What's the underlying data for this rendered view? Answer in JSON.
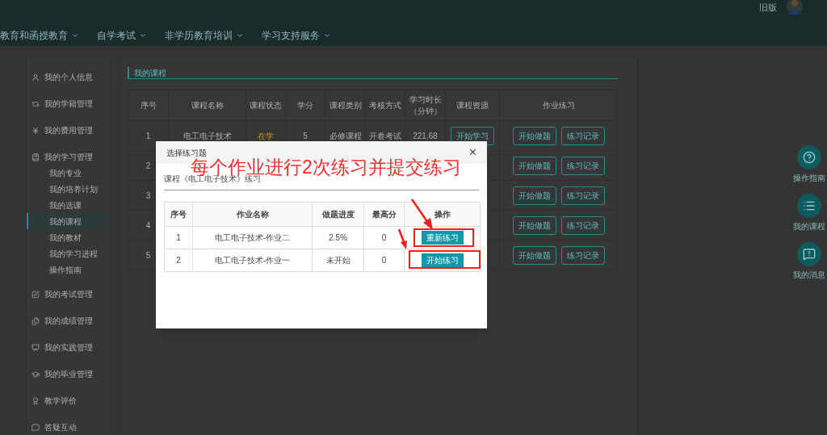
{
  "header": {
    "old_version_link": "旧版",
    "nav": [
      {
        "label": "教育和函授教育"
      },
      {
        "label": "自学考试"
      },
      {
        "label": "非学历教育培训"
      },
      {
        "label": "学习支持服务"
      }
    ]
  },
  "sidebar": {
    "items": [
      {
        "label": "我的个人信息",
        "selected": false
      },
      {
        "label": "我的学籍管理",
        "selected": false
      },
      {
        "label": "我的费用管理",
        "selected": false
      },
      {
        "label": "我的学习管理",
        "selected": false,
        "children": [
          {
            "label": "我的专业",
            "selected": false
          },
          {
            "label": "我的培养计划",
            "selected": false
          },
          {
            "label": "我的选课",
            "selected": false
          },
          {
            "label": "我的课程",
            "selected": true
          },
          {
            "label": "我的教材",
            "selected": false
          },
          {
            "label": "我的学习进程",
            "selected": false
          },
          {
            "label": "操作指南",
            "selected": false
          }
        ]
      },
      {
        "label": "我的考试管理",
        "selected": false
      },
      {
        "label": "我的成绩管理",
        "selected": false
      },
      {
        "label": "我的实践管理",
        "selected": false
      },
      {
        "label": "我的毕业管理",
        "selected": false
      },
      {
        "label": "教学评价",
        "selected": false
      },
      {
        "label": "答疑互动",
        "selected": false
      }
    ]
  },
  "section_title": "我的课程",
  "table": {
    "columns": [
      "序号",
      "课程名称",
      "课程状态",
      "学分",
      "课程类别",
      "考核方式",
      "学习时长（分钟）",
      "课程资源",
      "作业练习"
    ],
    "rows": [
      {
        "seq": "1",
        "name": "电工电子技术",
        "status": "在学",
        "credit": "5",
        "category": "必修课程",
        "assessment": "开卷考试",
        "duration": "221.68",
        "resource_button": "开始学习",
        "actions": [
          "开始做题",
          "练习记录"
        ]
      },
      {
        "seq": "2",
        "actions": [
          "开始做题",
          "练习记录"
        ]
      },
      {
        "seq": "3",
        "actions": [
          "开始做题",
          "练习记录"
        ]
      },
      {
        "seq": "4",
        "actions": [
          "开始做题",
          "练习记录"
        ]
      },
      {
        "seq": "5",
        "actions": [
          "开始做题",
          "练习记录"
        ]
      }
    ]
  },
  "floating_buttons": [
    {
      "label": "操作指南"
    },
    {
      "label": "我的课程"
    },
    {
      "label": "我的消息"
    }
  ],
  "dialog": {
    "title": "选择练习题",
    "close": "×",
    "subtitle": "课程《电工电子技术》练习",
    "columns": [
      "序号",
      "作业名称",
      "做题进度",
      "最高分",
      "操作"
    ],
    "rows": [
      {
        "seq": "1",
        "name": "电工电子技术-作业二",
        "progress": "2.5%",
        "top_score": "0",
        "action": "重新练习"
      },
      {
        "seq": "2",
        "name": "电工电子技术-作业一",
        "progress": "未开始",
        "top_score": "0",
        "action": "开始练习"
      }
    ]
  },
  "annotation": "每个作业进行2次练习并提交练习"
}
